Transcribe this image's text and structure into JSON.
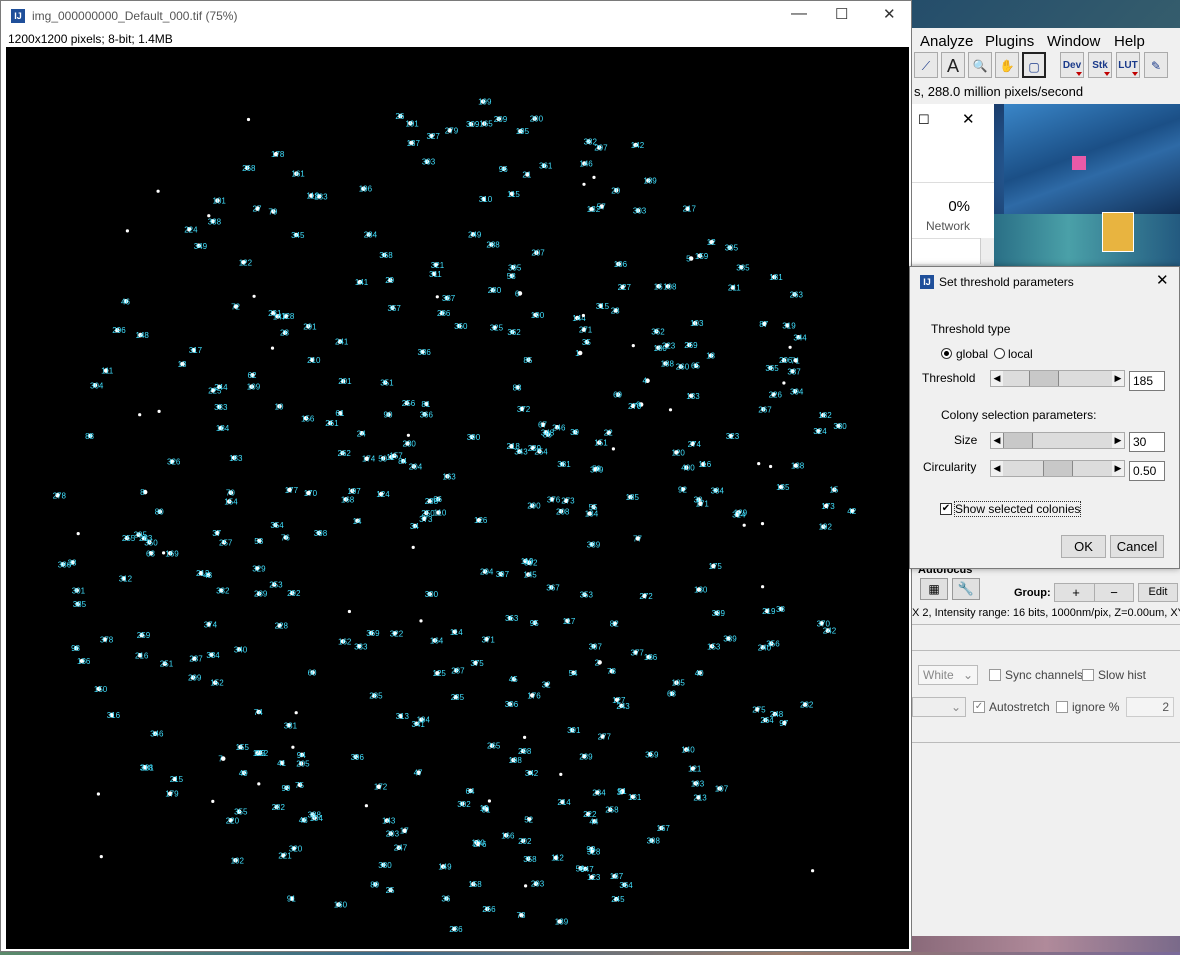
{
  "image_window": {
    "title": "img_000000000_Default_000.tif (75%)",
    "info": "1200x1200 pixels; 8-bit; 1.4MB",
    "window_buttons": [
      "—",
      "☐",
      "✕"
    ]
  },
  "imagej": {
    "menus": [
      "Analyze",
      "Plugins",
      "Window",
      "Help"
    ],
    "tools": [
      "⟋",
      "A",
      "🔍",
      "✋",
      "▢",
      "Dev",
      "Stk",
      "LUT",
      "✎"
    ],
    "status": "s, 288.0 million pixels/second"
  },
  "task_manager": {
    "network_percent": "0%",
    "network_label": "Network"
  },
  "dialog": {
    "title": "Set threshold parameters",
    "threshold_type_label": "Threshold type",
    "radio_global": "global",
    "radio_local": "local",
    "threshold_label": "Threshold",
    "threshold_value": "185",
    "threshold_fraction": 0.38,
    "colony_section_label": "Colony selection parameters:",
    "size_label": "Size",
    "size_value": "30",
    "size_fraction": 0.12,
    "circularity_label": "Circularity",
    "circularity_value": "0.50",
    "circularity_fraction": 0.5,
    "show_colonies_label": "Show selected colonies",
    "ok_label": "OK",
    "cancel_label": "Cancel"
  },
  "micro_manager": {
    "autofocus_label": "Autofocus",
    "group_label": "Group:",
    "add_label": "+",
    "remove_label": "−",
    "edit_label": "Edit",
    "camera_info": "X 2, Intensity range: 16 bits, 1000nm/pix, Z=0.00um, XY=",
    "color_select": "White",
    "sync_channels": "Sync channels",
    "slow_hist": "Slow hist",
    "autostretch": "Autostretch",
    "ignore_pct": "ignore %",
    "ignore_value": "2"
  },
  "colony_labels": [
    "1",
    "2",
    "3",
    "4",
    "5",
    "6",
    "7",
    "8",
    "9",
    "10",
    "11",
    "12",
    "13",
    "14",
    "15",
    "16",
    "17",
    "18",
    "19",
    "20",
    "21",
    "22",
    "23",
    "24",
    "25",
    "26",
    "27",
    "28",
    "29",
    "30",
    "31",
    "32",
    "33",
    "34",
    "35",
    "36",
    "37",
    "38",
    "39",
    "40",
    "41",
    "42",
    "43",
    "44",
    "45",
    "46",
    "47",
    "48",
    "49",
    "50",
    "51",
    "52",
    "53",
    "54",
    "55",
    "56",
    "57",
    "58",
    "59",
    "60",
    "61",
    "62",
    "63",
    "64",
    "65",
    "66",
    "67",
    "68",
    "69",
    "70",
    "71",
    "72",
    "73",
    "74",
    "75",
    "76",
    "77",
    "78",
    "79",
    "80",
    "81",
    "82",
    "83",
    "84",
    "85",
    "86",
    "87",
    "88",
    "89",
    "90",
    "91",
    "92",
    "93",
    "94",
    "95",
    "96",
    "97",
    "98",
    "99",
    "100",
    "101",
    "102",
    "103",
    "104",
    "105",
    "106",
    "107",
    "108",
    "109",
    "110",
    "111",
    "112",
    "113",
    "114",
    "115",
    "116",
    "117",
    "118",
    "119",
    "120",
    "121",
    "122",
    "123",
    "124",
    "125",
    "126",
    "127",
    "128",
    "129",
    "130",
    "131",
    "132",
    "133",
    "134",
    "135",
    "136",
    "137",
    "138",
    "139",
    "140",
    "141",
    "142",
    "143",
    "144",
    "145",
    "146",
    "147",
    "148",
    "149",
    "150",
    "151",
    "152",
    "153",
    "154",
    "155",
    "156",
    "157",
    "158",
    "159",
    "160",
    "161",
    "162",
    "163",
    "164",
    "165",
    "166",
    "167",
    "168",
    "169",
    "170",
    "171",
    "172",
    "173",
    "174",
    "175",
    "176",
    "177",
    "178",
    "179",
    "180",
    "181",
    "182",
    "183",
    "184",
    "185",
    "186",
    "187",
    "188",
    "189",
    "190",
    "191",
    "192",
    "193",
    "194",
    "195",
    "196",
    "197",
    "198",
    "199",
    "200",
    "201",
    "202",
    "203",
    "204",
    "205",
    "206",
    "207",
    "208",
    "209",
    "210",
    "211",
    "212",
    "213",
    "214",
    "215",
    "216",
    "217",
    "218",
    "219",
    "220",
    "221",
    "222",
    "223",
    "224",
    "225",
    "226",
    "227",
    "228",
    "229",
    "230",
    "231",
    "232",
    "233",
    "234",
    "235",
    "236",
    "237",
    "238",
    "239",
    "240",
    "241",
    "242",
    "243",
    "244",
    "245",
    "246",
    "247",
    "248",
    "249",
    "250",
    "251",
    "252",
    "253",
    "254",
    "255",
    "256",
    "257",
    "258",
    "259",
    "260",
    "261",
    "262",
    "263",
    "264",
    "265",
    "266",
    "267",
    "268",
    "269",
    "270",
    "271",
    "272",
    "273",
    "274",
    "275",
    "276",
    "277",
    "278",
    "279",
    "280",
    "281",
    "282",
    "283",
    "284",
    "285",
    "286",
    "287",
    "288",
    "289",
    "290",
    "291",
    "292",
    "293",
    "294",
    "295",
    "296",
    "297",
    "298",
    "299",
    "300",
    "301",
    "302",
    "303",
    "304",
    "305",
    "306",
    "307",
    "308",
    "309",
    "310",
    "311",
    "312",
    "313",
    "314",
    "315",
    "316",
    "317",
    "318",
    "319",
    "320",
    "321",
    "322",
    "323",
    "324",
    "325",
    "326",
    "327",
    "328",
    "329",
    "330",
    "331",
    "332",
    "333",
    "334",
    "335",
    "336",
    "337",
    "338",
    "339",
    "340",
    "341",
    "342",
    "343",
    "344",
    "345",
    "346",
    "347",
    "348",
    "349",
    "350",
    "351",
    "352",
    "353",
    "354",
    "355",
    "356",
    "357",
    "358",
    "359",
    "360",
    "361",
    "362",
    "363",
    "364",
    "365",
    "366",
    "367",
    "368",
    "369",
    "370",
    "371",
    "372",
    "373",
    "374",
    "375",
    "376",
    "377",
    "378",
    "379",
    "380",
    "381",
    "382",
    "383",
    "384",
    "385",
    "386",
    "387",
    "388",
    "389",
    "390",
    "391",
    "392",
    "393",
    "394",
    "395",
    "396",
    "397",
    "398",
    "399",
    "400"
  ],
  "colors": {
    "label": "#40e0ff",
    "colony": "#ffffff",
    "canvas": "#000000"
  }
}
